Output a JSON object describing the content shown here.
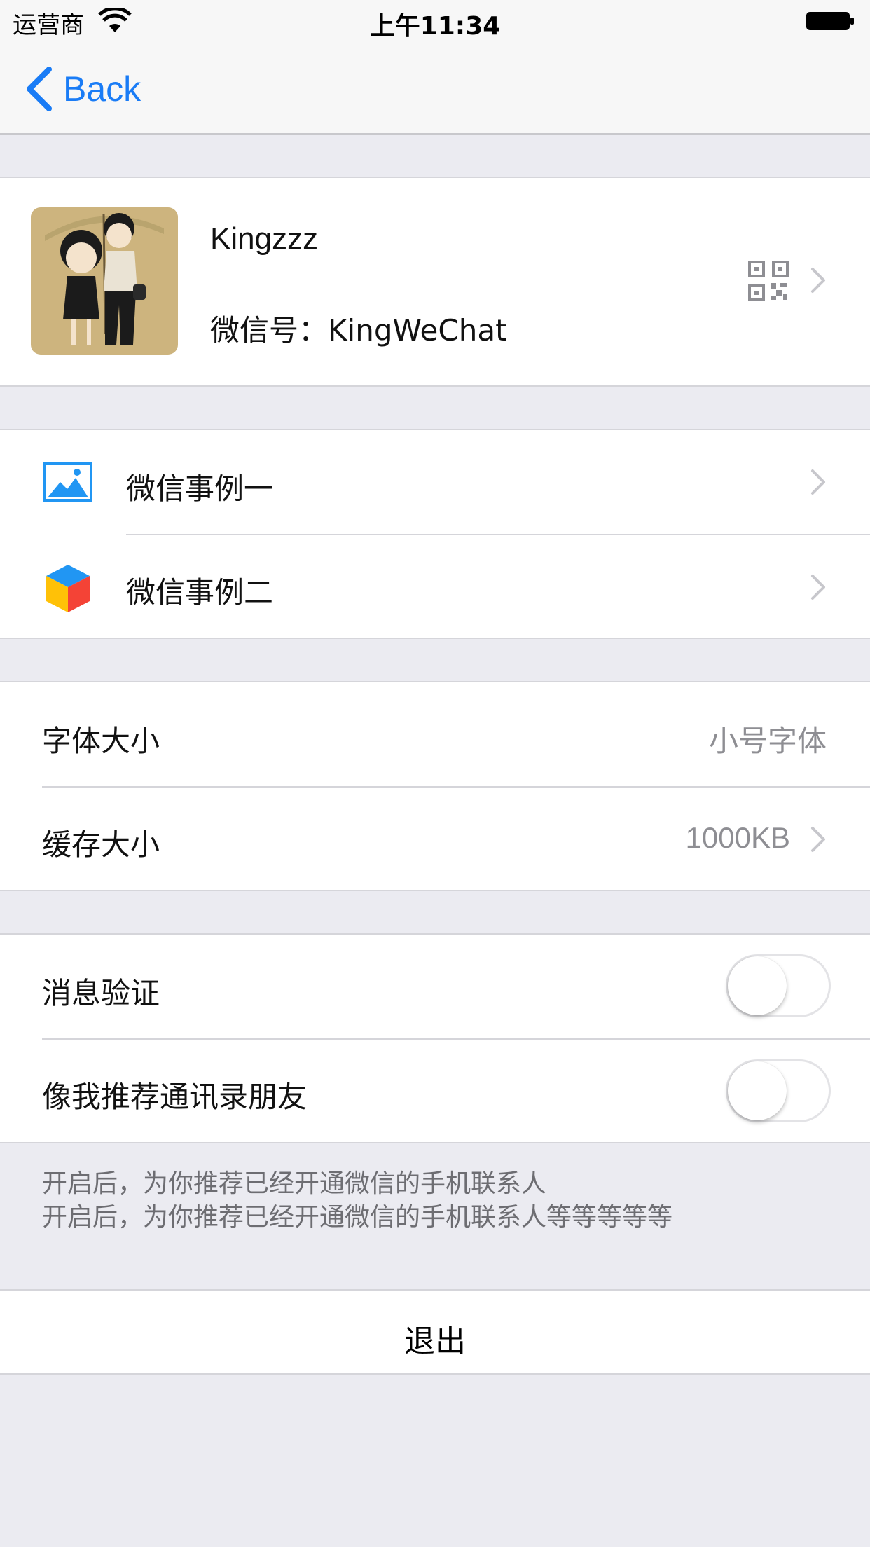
{
  "status_bar": {
    "carrier": "运营商",
    "time": "上午11:34"
  },
  "nav": {
    "back_label": "Back"
  },
  "profile": {
    "name": "Kingzzz",
    "wechat_id": "微信号：KingWeChat"
  },
  "examples": {
    "items": [
      {
        "label": "微信事例一",
        "icon": "picture-icon"
      },
      {
        "label": "微信事例二",
        "icon": "cube-icon"
      }
    ]
  },
  "settings": {
    "font_size": {
      "label": "字体大小",
      "value": "小号字体"
    },
    "cache_size": {
      "label": "缓存大小",
      "value": "1000KB"
    }
  },
  "toggles": {
    "message_verification": {
      "label": "消息验证",
      "on": false
    },
    "recommend_contacts": {
      "label": "像我推荐通讯录朋友",
      "on": false
    }
  },
  "footer": {
    "line1": "开启后，为你推荐已经开通微信的手机联系人",
    "line2": "开启后，为你推荐已经开通微信的手机联系人等等等等等"
  },
  "logout_label": "退出",
  "colors": {
    "accent": "#1A7CF6",
    "background": "#EBEBF1",
    "separator": "#D5D5DA",
    "detail": "#8E8E93"
  }
}
